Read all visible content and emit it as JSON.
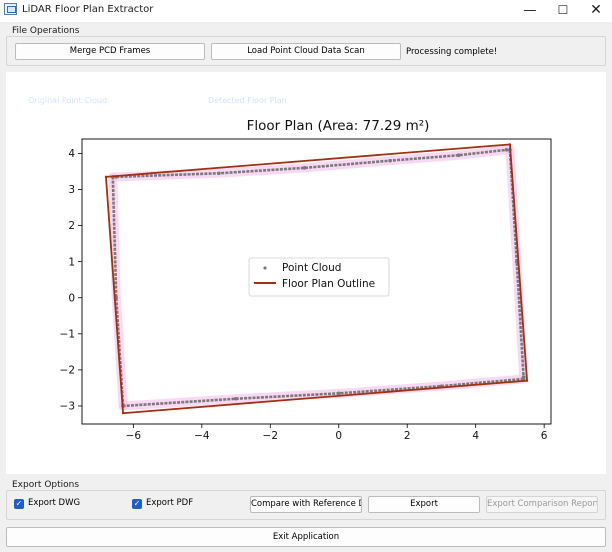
{
  "window": {
    "title": "LiDAR Floor Plan Extractor",
    "minimize_glyph": "—",
    "maximize_glyph": "☐",
    "close_glyph": "✕"
  },
  "file_ops": {
    "label": "File Operations",
    "merge_button": "Merge PCD Frames",
    "load_button": "Load Point Cloud Data Scan",
    "status": "Processing complete!"
  },
  "chart_data": {
    "type": "line",
    "title": "Floor Plan (Area: 77.29 m²)",
    "xlim": [
      -7.5,
      6.2
    ],
    "ylim": [
      -3.5,
      4.4
    ],
    "x_ticks": [
      -6,
      -4,
      -2,
      0,
      2,
      4,
      6
    ],
    "y_ticks": [
      -3,
      -2,
      -1,
      0,
      1,
      2,
      3,
      4
    ],
    "grid": false,
    "legend_placement": "center",
    "series": [
      {
        "name": "Point Cloud",
        "style": "scatter",
        "color": "#7a7a7a",
        "segments": [
          {
            "x": [
              -6.5,
              -3.5,
              -1.0,
              1.5,
              3.5,
              4.9
            ],
            "y": [
              3.35,
              3.45,
              3.6,
              3.8,
              3.95,
              4.1
            ]
          },
          {
            "x": [
              5.0,
              5.2,
              5.4
            ],
            "y": [
              4.1,
              1.0,
              -2.2
            ]
          },
          {
            "x": [
              5.4,
              3.0,
              0.0,
              -3.0,
              -6.3
            ],
            "y": [
              -2.25,
              -2.45,
              -2.65,
              -2.8,
              -3.0
            ]
          },
          {
            "x": [
              -6.3,
              -6.5,
              -6.6
            ],
            "y": [
              -3.0,
              0.0,
              3.35
            ]
          }
        ]
      },
      {
        "name": "Floor Plan Outline",
        "style": "line",
        "color": "#a0300e",
        "x": [
          -6.8,
          5.0,
          5.5,
          -6.3,
          -6.8
        ],
        "y": [
          3.35,
          4.25,
          -2.3,
          -3.2,
          3.35
        ]
      }
    ],
    "shadow_color": "#f7c8ef"
  },
  "ghost_text": {
    "left": "Original Point Cloud",
    "right": "Detected Floor Plan"
  },
  "export_ops": {
    "label": "Export Options",
    "dwg_label": "Export DWG",
    "pdf_label": "Export PDF",
    "compare_button": "Compare with Reference DXF",
    "export_button": "Export",
    "report_button": "Export Comparison Report",
    "check_glyph": "✓"
  },
  "footer": {
    "exit_button": "Exit Application"
  }
}
